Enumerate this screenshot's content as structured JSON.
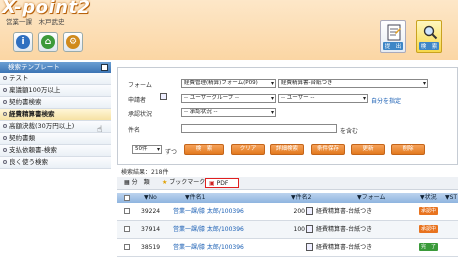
{
  "header": {
    "logo": "X-point2",
    "user_line": "営業一課　木戸武史",
    "buttons": [
      {
        "name": "info-icon",
        "glyph": "i",
        "color": "#2e6fc0"
      },
      {
        "name": "home-icon",
        "glyph": "⌂",
        "color": "#3d9a3a"
      },
      {
        "name": "settings-icon",
        "glyph": "⚙",
        "color": "#d08a1c"
      }
    ],
    "submit_label": "提　出",
    "search_label": "検　索"
  },
  "sidebar": {
    "title": "検索テンプレート",
    "items": [
      {
        "label": "テスト",
        "active": false
      },
      {
        "label": "稟議額100万以上",
        "active": false
      },
      {
        "label": "契約書検索",
        "active": false
      },
      {
        "label": "経費精算書検索",
        "active": true
      },
      {
        "label": "高額決裁(30万円以上)",
        "active": false
      },
      {
        "label": "契約書類",
        "active": false
      },
      {
        "label": "支払依頼書-検索",
        "active": false
      },
      {
        "label": "良く使う検索",
        "active": false
      }
    ]
  },
  "form": {
    "form_label": "フォーム",
    "form_select1": "経費管理(精算)フォーム(P09)",
    "form_select2": "経費精算書-台紙つき",
    "applicant_label": "申請者",
    "user_group_select": "-- ユーザーグループ --",
    "user_select": "-- ユーザー --",
    "self_specify_link": "自分を指定",
    "approval_status_label": "承認状況",
    "approval_status_select": "-- 承認状況 --",
    "subject_label": "件名",
    "subject_value": "",
    "contains_text": "を含む",
    "count_select": "50件",
    "per_page_text": "ずつ",
    "buttons": [
      "検　索",
      "クリア",
      "詳細検索",
      "条件保存",
      "更新",
      "削除"
    ]
  },
  "results": {
    "summary": "検索結果：218件",
    "toolbar": {
      "split": "分　類",
      "bookmark": "ブックマーク",
      "pdf": "PDF"
    },
    "columns": [
      "No",
      "件名1",
      "件名2",
      "フォーム",
      "状況",
      "ST"
    ],
    "rows": [
      {
        "no": "39224",
        "title1": "営業一課/膝 太郎/100396",
        "title2": "200",
        "form": "経費精算書-台紙つき",
        "status": "承認中",
        "status_color": "#e8731f"
      },
      {
        "no": "37914",
        "title1": "営業一課/膝 太郎/100396",
        "title2": "100",
        "form": "経費精算書-台紙つき",
        "status": "承認中",
        "status_color": "#e8731f"
      },
      {
        "no": "38519",
        "title1": "営業一課/膝 太郎/100396",
        "title2": "",
        "form": "経費精算書-台紙つき",
        "status": "完　了",
        "status_color": "#3a9a3a"
      }
    ]
  }
}
